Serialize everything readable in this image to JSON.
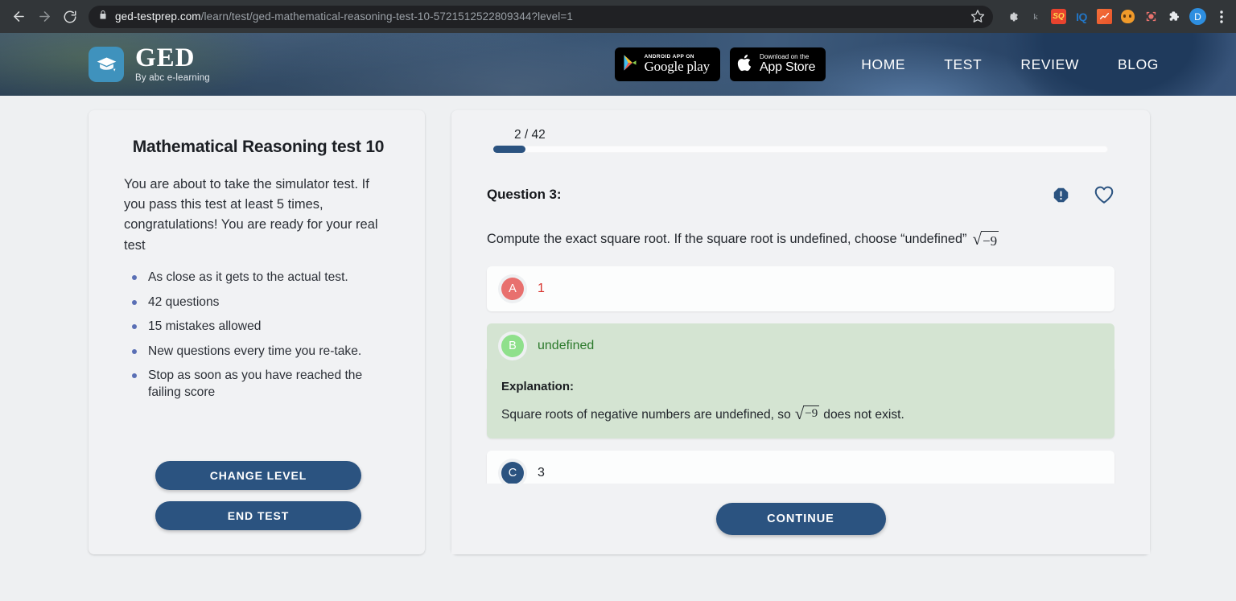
{
  "browser": {
    "url_host": "ged-testprep.com",
    "url_path": "/learn/test/ged-mathematical-reasoning-test-10-5721512522809344?level=1",
    "back_icon": "back-arrow-icon",
    "forward_icon": "forward-arrow-icon",
    "reload_icon": "reload-icon",
    "lock_icon": "lock-icon",
    "bookmark_icon": "star-icon",
    "extensions": [
      {
        "name": "gear-extension-icon",
        "label": ""
      },
      {
        "name": "k-extension-icon",
        "label": "k"
      },
      {
        "name": "sq-extension-icon",
        "label": "SQ"
      },
      {
        "name": "iq-extension-icon",
        "label": "IQ"
      },
      {
        "name": "chart-extension-icon",
        "label": ""
      },
      {
        "name": "bot-extension-icon",
        "label": ""
      },
      {
        "name": "target-extension-icon",
        "label": ""
      },
      {
        "name": "puzzle-extensions-icon",
        "label": ""
      }
    ],
    "profile_initial": "D",
    "menu_icon": "three-dots-menu-icon"
  },
  "site_header": {
    "logo_icon": "graduation-cap-icon",
    "logo_title": "GED",
    "logo_subtitle": "By abc e-learning",
    "badges": [
      {
        "small": "ANDROID APP ON",
        "big": "Google play",
        "icon": "google-play-icon"
      },
      {
        "small": "Download on the",
        "big": "App Store",
        "icon": "apple-logo-icon"
      }
    ],
    "nav": [
      {
        "label": "HOME"
      },
      {
        "label": "TEST"
      },
      {
        "label": "REVIEW"
      },
      {
        "label": "BLOG"
      }
    ]
  },
  "left_panel": {
    "title": "Mathematical Reasoning test 10",
    "intro": "You are about to take the simulator test. If you pass this test at least 5 times, congratulations! You are ready for your real test",
    "bullets": [
      "As close as it gets to the actual test.",
      "42 questions",
      "15 mistakes allowed",
      "New questions every time you re-take.",
      "Stop as soon as you have reached the failing score"
    ],
    "change_level_label": "CHANGE LEVEL",
    "end_test_label": "END TEST"
  },
  "test_panel": {
    "progress_text": "2 / 42",
    "progress_current": 2,
    "progress_total": 42,
    "question_label": "Question 3:",
    "report_icon": "exclamation-octagon-icon",
    "favorite_icon": "heart-outline-icon",
    "question_text": "Compute the exact square root. If the square root is undefined, choose “undefined”",
    "question_math_radicand": "−9",
    "options": [
      {
        "letter": "A",
        "text": "1",
        "state": "wrong"
      },
      {
        "letter": "B",
        "text": "undefined",
        "state": "correct"
      },
      {
        "letter": "C",
        "text": "3",
        "state": "neutral"
      }
    ],
    "explanation_title": "Explanation:",
    "explanation_before": "Square roots of negative numbers are undefined, so",
    "explanation_math_radicand": "−9",
    "explanation_after": "does not exist.",
    "continue_label": "CONTINUE"
  },
  "colors": {
    "brand_navy": "#2b5380",
    "logo_blue": "#3f92bd",
    "correct_bg": "#d4e4d2",
    "correct_text": "#2c7a2c",
    "wrong_text": "#d8352f",
    "wrong_bubble": "#e8706e",
    "right_bubble": "#8fe08c",
    "page_bg": "#eef0f2",
    "card_bg": "#f1f2f4"
  }
}
